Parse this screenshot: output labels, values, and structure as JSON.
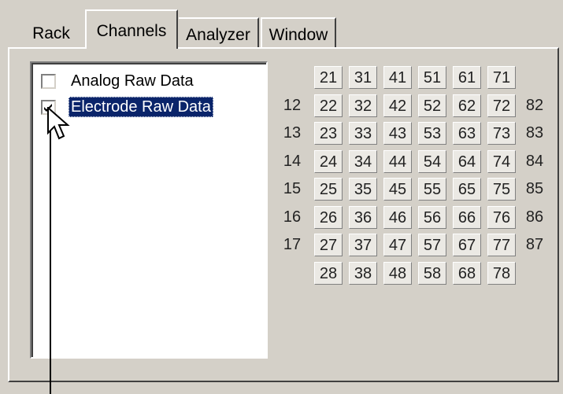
{
  "tabs": [
    {
      "label": "Rack",
      "active": false
    },
    {
      "label": "Channels",
      "active": true
    },
    {
      "label": "Analyzer",
      "active": false
    },
    {
      "label": "Window",
      "active": false
    }
  ],
  "list": {
    "items": [
      {
        "label": "Analog Raw Data",
        "checked": false,
        "selected": false
      },
      {
        "label": "Electrode Raw Data",
        "checked": true,
        "selected": true
      }
    ]
  },
  "electrode_grid": {
    "rows": [
      [
        null,
        "21",
        "31",
        "41",
        "51",
        "61",
        "71",
        null
      ],
      [
        "12",
        "22",
        "32",
        "42",
        "52",
        "62",
        "72",
        "82"
      ],
      [
        "13",
        "23",
        "33",
        "43",
        "53",
        "63",
        "73",
        "83"
      ],
      [
        "14",
        "24",
        "34",
        "44",
        "54",
        "64",
        "74",
        "84"
      ],
      [
        "15",
        "25",
        "35",
        "45",
        "55",
        "65",
        "75",
        "85"
      ],
      [
        "16",
        "26",
        "36",
        "46",
        "56",
        "66",
        "76",
        "86"
      ],
      [
        "17",
        "27",
        "37",
        "47",
        "57",
        "67",
        "77",
        "87"
      ],
      [
        null,
        "28",
        "38",
        "48",
        "58",
        "68",
        "78",
        null
      ]
    ]
  },
  "icons": {
    "cursor": "arrow-pointer-icon",
    "check": "checkmark-icon"
  },
  "colors": {
    "window_face": "#d4d0c8",
    "selection": "#0a246a",
    "button_face": "#ebe9e4"
  }
}
